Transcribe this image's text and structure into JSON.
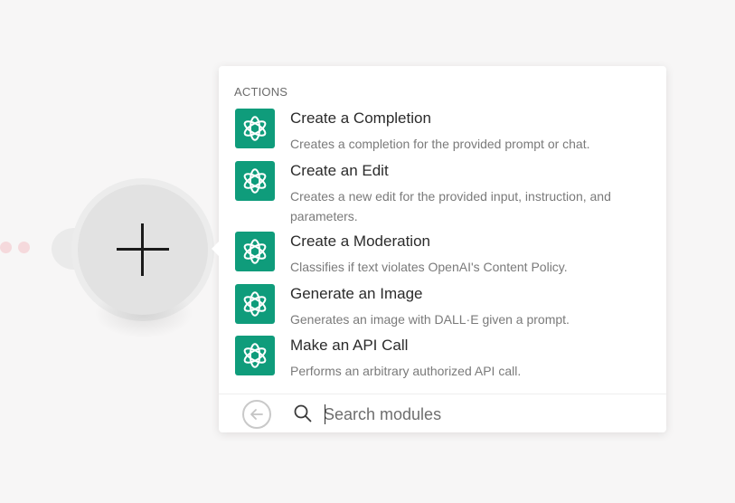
{
  "popup": {
    "section_title": "ACTIONS",
    "items": [
      {
        "title": "Create a Completion",
        "description": "Creates a completion for the provided prompt or chat.",
        "icon": "openai-icon"
      },
      {
        "title": "Create an Edit",
        "description": "Creates a new edit for the provided input, instruction, and parameters.",
        "icon": "openai-icon"
      },
      {
        "title": "Create a Moderation",
        "description": "Classifies if text violates OpenAI's Content Policy.",
        "icon": "openai-icon"
      },
      {
        "title": "Generate an Image",
        "description": "Generates an image with DALL·E given a prompt.",
        "icon": "openai-icon"
      },
      {
        "title": "Make an API Call",
        "description": "Performs an arbitrary authorized API call.",
        "icon": "openai-icon"
      }
    ],
    "search": {
      "placeholder": "Search modules",
      "value": ""
    }
  },
  "node": {
    "icon": "plus-icon"
  },
  "colors": {
    "icon_bg": "#0f9c7b",
    "node_bg": "#e2e2e2",
    "canvas_bg": "#f7f6f6"
  }
}
